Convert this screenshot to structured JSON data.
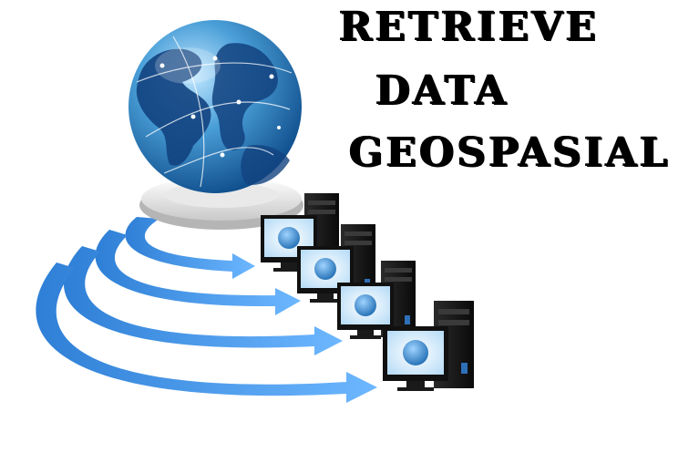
{
  "title": {
    "line1": "RETRIEVE",
    "line2": "DATA",
    "line3": "GEOSPASIAL"
  },
  "colors": {
    "text": "#000000",
    "background": "#ffffff",
    "arrow": "#3a8ee8",
    "arrow_light": "#7cc0ff",
    "globe_ocean": "#3f93cf",
    "globe_land": "#123f7a",
    "monitor_screen": "#dff1ff",
    "server_body": "#151515"
  },
  "icons": [
    "globe-icon",
    "arrow-icon",
    "computer-icon",
    "server-tower-icon"
  ]
}
